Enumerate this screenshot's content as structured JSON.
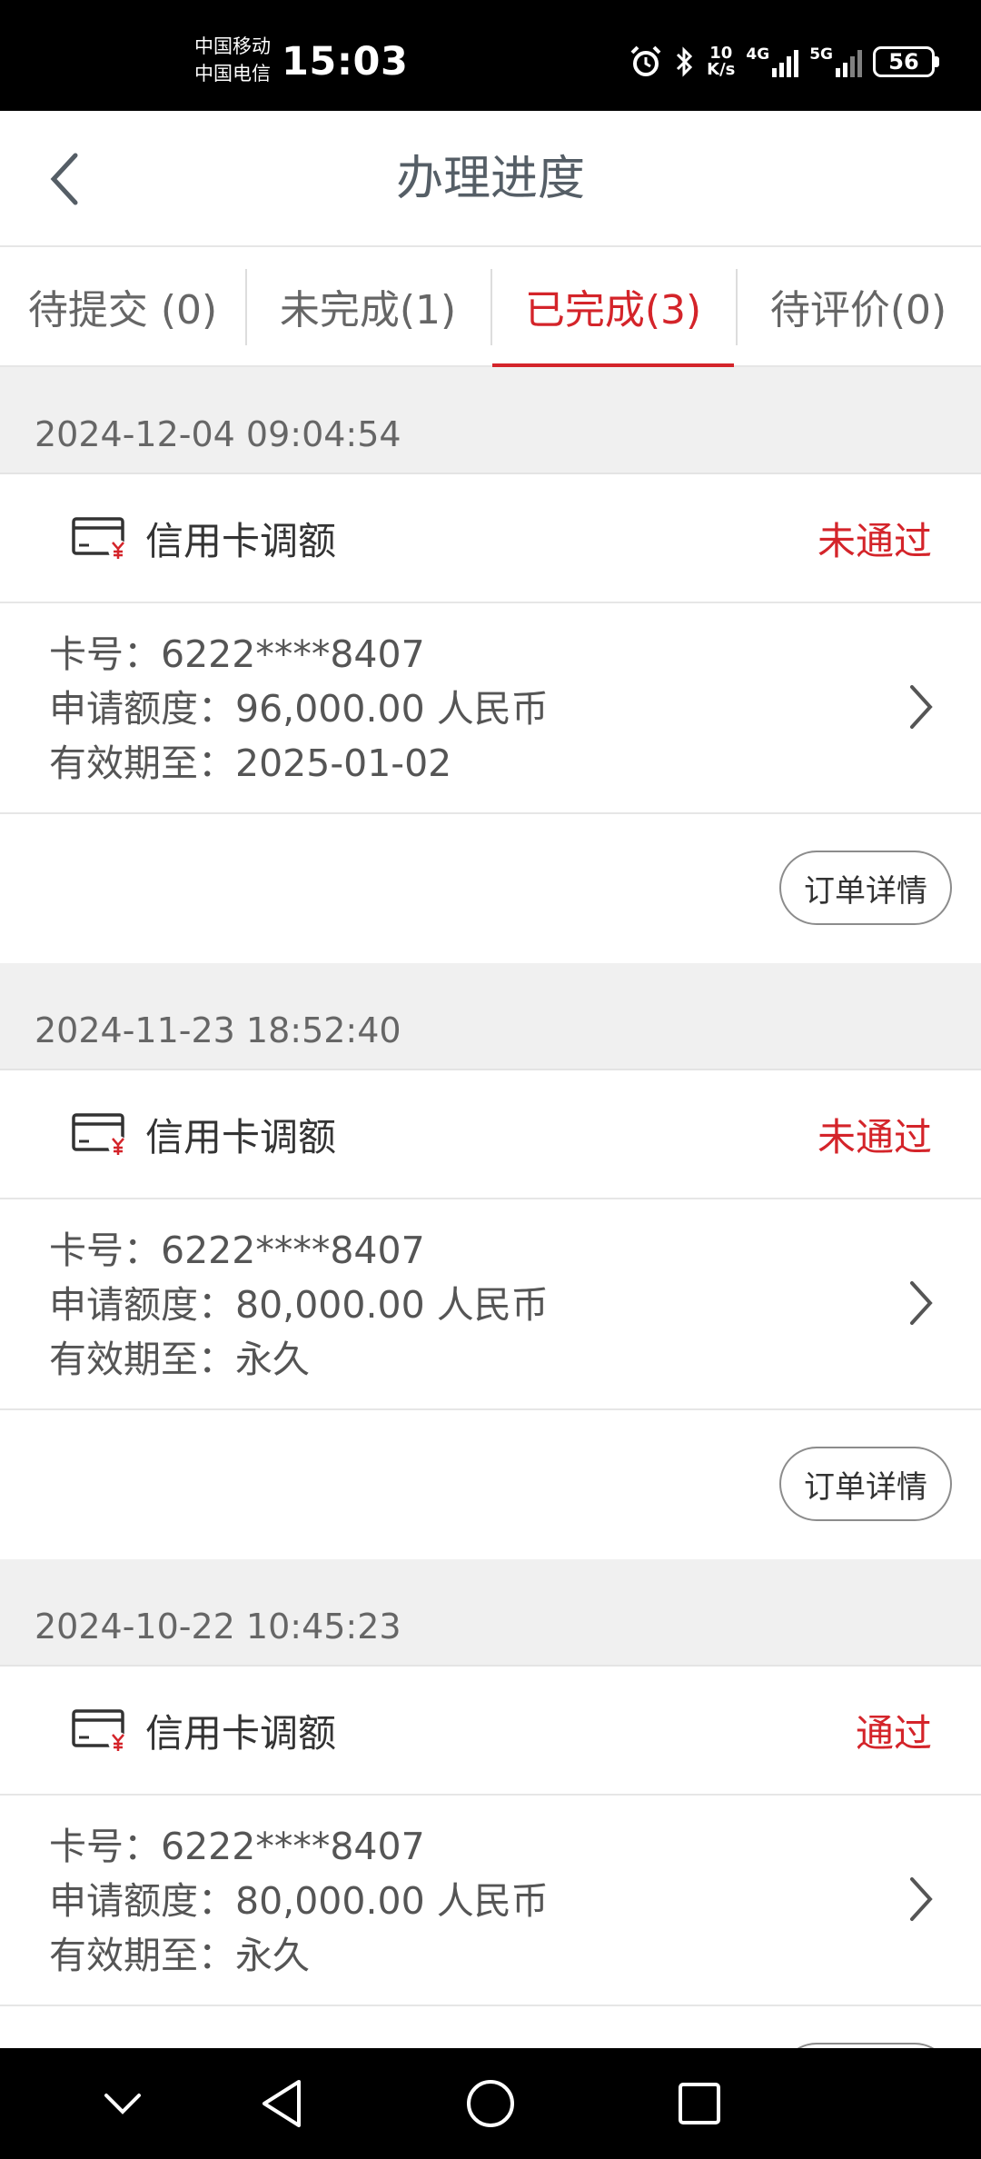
{
  "status_bar": {
    "carrier_1": "中国移动",
    "carrier_2": "中国电信",
    "time": "15:03",
    "net_speed_value": "10",
    "net_speed_unit": "K/s",
    "signal_1_label": "4G",
    "signal_2_label": "5G",
    "battery": "56"
  },
  "header": {
    "title": "办理进度"
  },
  "tabs": [
    {
      "label": "待提交 (0)",
      "active": false
    },
    {
      "label": "未完成(1)",
      "active": false
    },
    {
      "label": "已完成(3)",
      "active": true
    },
    {
      "label": "待评价(0)",
      "active": false
    }
  ],
  "labels": {
    "card_no": "卡号：",
    "amount": "申请额度：",
    "valid_until": "有效期至：",
    "detail_button": "订单详情"
  },
  "records": [
    {
      "date": "2024-12-04 09:04:54",
      "service": "信用卡调额",
      "status": "未通过",
      "card_no": "6222****8407",
      "amount": "96,000.00 人民币",
      "valid_until": "2025-01-02"
    },
    {
      "date": "2024-11-23 18:52:40",
      "service": "信用卡调额",
      "status": "未通过",
      "card_no": "6222****8407",
      "amount": "80,000.00 人民币",
      "valid_until": "永久"
    },
    {
      "date": "2024-10-22 10:45:23",
      "service": "信用卡调额",
      "status": "通过",
      "card_no": "6222****8407",
      "amount": "80,000.00 人民币",
      "valid_until": "永久"
    }
  ],
  "colors": {
    "accent": "#d4242a",
    "text_primary": "#333333",
    "text_secondary": "#555555",
    "background": "#f0f0f0"
  },
  "icons": {
    "back": "chevron-left-icon",
    "card": "credit-card-yuan-icon",
    "row": "chevron-right-icon"
  }
}
